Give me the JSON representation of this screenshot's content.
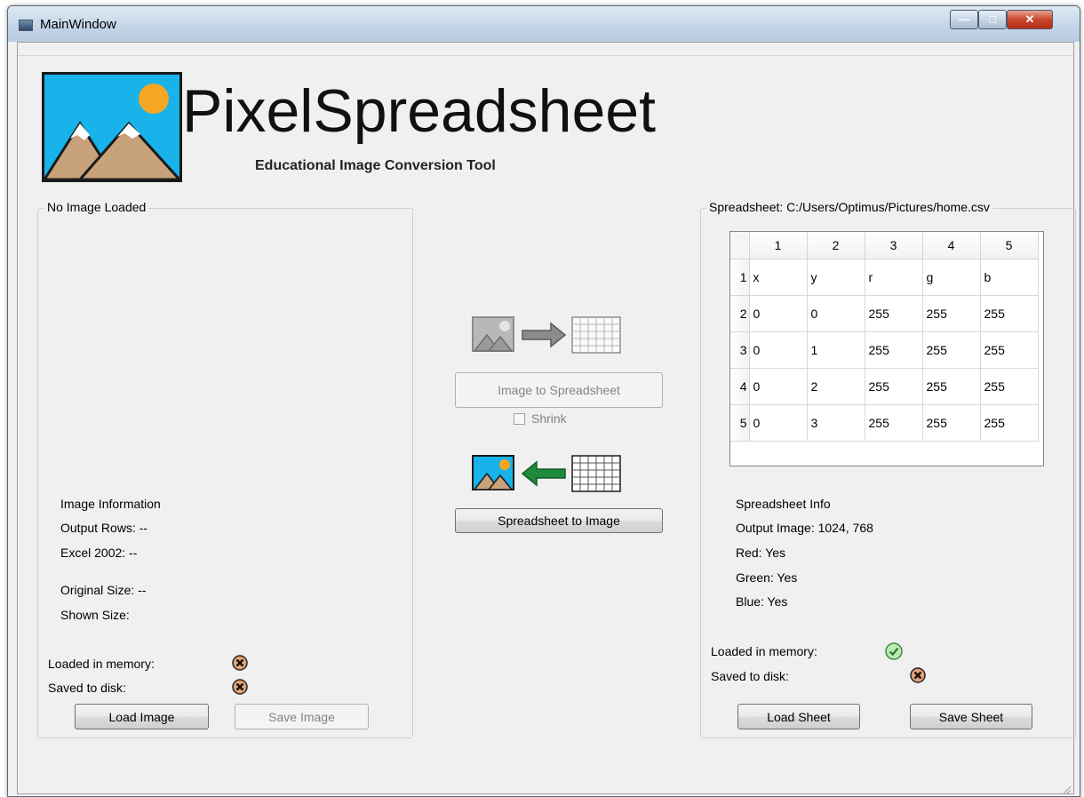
{
  "window": {
    "title": "MainWindow",
    "controls": {
      "minimize_icon": "minimize-icon",
      "maximize_icon": "maximize-icon",
      "close_icon": "close-icon"
    }
  },
  "app": {
    "title": "PixelSpreadsheet",
    "subtitle": "Educational Image Conversion Tool",
    "logo_icon": "landscape-image-icon"
  },
  "image_panel": {
    "group_title": "No Image Loaded",
    "info_heading": "Image Information",
    "output_rows": "Output Rows: --",
    "excel_2002": "Excel 2002: --",
    "original_size": "Original Size: --",
    "shown_size": "Shown Size:",
    "loaded_label": "Loaded in memory:",
    "saved_label": "Saved to disk:",
    "loaded_status": "x-icon",
    "saved_status": "x-icon",
    "load_button": "Load Image",
    "save_button": "Save Image",
    "save_button_enabled": false
  },
  "convert": {
    "to_sheet_button": "Image to Spreadsheet",
    "to_sheet_enabled": false,
    "shrink_label": "Shrink",
    "shrink_checked": false,
    "to_image_button": "Spreadsheet to Image",
    "to_sheet_icon": "image-to-grid-icon",
    "to_image_icon": "grid-to-image-icon"
  },
  "sheet_panel": {
    "group_title": "Spreadsheet: C:/Users/Optimus/Pictures/home.csv",
    "columns": [
      "1",
      "2",
      "3",
      "4",
      "5"
    ],
    "rows": [
      {
        "header": "1",
        "cells": [
          "x",
          "y",
          "r",
          "g",
          "b"
        ]
      },
      {
        "header": "2",
        "cells": [
          "0",
          "0",
          "255",
          "255",
          "255"
        ]
      },
      {
        "header": "3",
        "cells": [
          "0",
          "1",
          "255",
          "255",
          "255"
        ]
      },
      {
        "header": "4",
        "cells": [
          "0",
          "2",
          "255",
          "255",
          "255"
        ]
      },
      {
        "header": "5",
        "cells": [
          "0",
          "3",
          "255",
          "255",
          "255"
        ]
      }
    ],
    "info_heading": "Spreadsheet Info",
    "output_image": "Output Image: 1024, 768",
    "red": "Red: Yes",
    "green": "Green: Yes",
    "blue": "Blue: Yes",
    "loaded_label": "Loaded in memory:",
    "saved_label": "Saved to disk:",
    "loaded_status": "check-icon",
    "saved_status": "x-icon",
    "load_button": "Load Sheet",
    "save_button": "Save Sheet"
  },
  "colors": {
    "sky": "#17b3ea",
    "sun": "#f5a623",
    "mountain": "#c8a27a",
    "snow": "#ffffff",
    "arrow_gray": "#8c8c8c",
    "arrow_green": "#1e8a3c",
    "status_check": "#5cb85c",
    "status_x": "#e8a07a"
  }
}
